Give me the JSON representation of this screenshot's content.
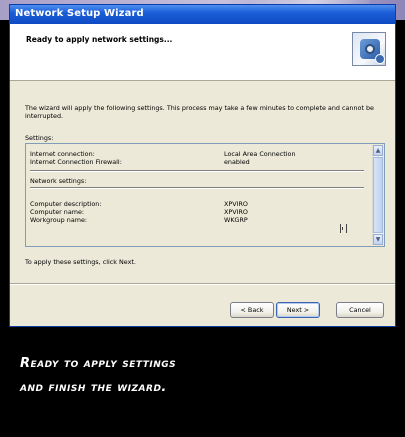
{
  "window": {
    "title": "Network Setup Wizard"
  },
  "header": {
    "heading": "Ready to apply network settings...",
    "icon": "network-wizard-icon"
  },
  "body": {
    "description": "The wizard will apply the following settings. This process may take a few minutes to complete and cannot be interrupted.",
    "settings_label": "Settings:",
    "settings": [
      {
        "label": "Internet connection:",
        "value": "Local Area Connection"
      },
      {
        "label": "Internet Connection Firewall:",
        "value": "enabled"
      },
      {
        "label": "Network settings:",
        "value": ""
      },
      {
        "label": "Computer description:",
        "value": "XPVIRO"
      },
      {
        "label": "Computer name:",
        "value": "XPVIRO"
      },
      {
        "label": "Workgroup name:",
        "value": "WKGRP"
      }
    ],
    "footer_text": "To apply these settings, click Next."
  },
  "buttons": {
    "back": "< Back",
    "next": "Next >",
    "cancel": "Cancel"
  },
  "caption": {
    "line1": "Ready to apply settings",
    "line2": "and finish the wizard."
  },
  "colors": {
    "titlebar": "#1b5ed8",
    "window_bg": "#ece9d8"
  }
}
